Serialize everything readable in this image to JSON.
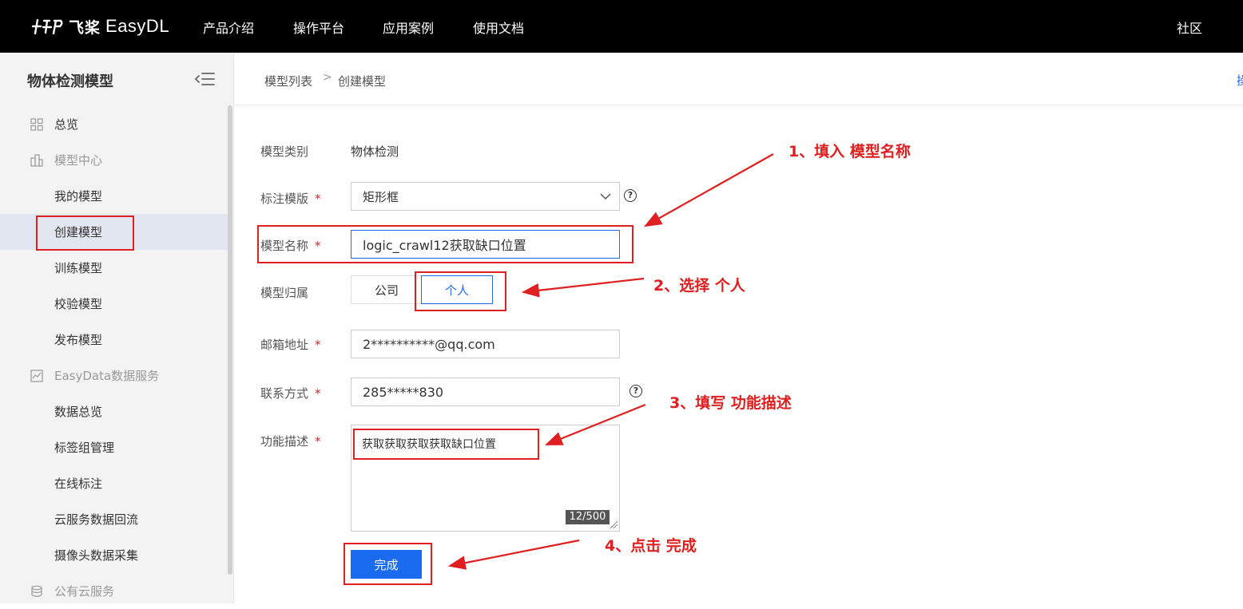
{
  "header": {
    "logo_cn": "飞桨",
    "logo_en": "EasyDL",
    "nav": [
      "产品介绍",
      "操作平台",
      "应用案例",
      "使用文档"
    ],
    "right_link": "社区"
  },
  "sidebar": {
    "title": "物体检测模型",
    "overview": "总览",
    "model_center": "模型中心",
    "model_items": [
      "我的模型",
      "创建模型",
      "训练模型",
      "校验模型",
      "发布模型"
    ],
    "data_service": "EasyData数据服务",
    "data_items": [
      "数据总览",
      "标签组管理",
      "在线标注",
      "云服务数据回流",
      "摄像头数据采集"
    ],
    "public_cloud": "公有云服务"
  },
  "breadcrumb": {
    "list": "模型列表",
    "sep": ">",
    "current": "创建模型",
    "edge": "操"
  },
  "form": {
    "type_label": "模型类别",
    "type_value": "物体检测",
    "template_label": "标注模版",
    "template_value": "矩形框",
    "name_label": "模型名称",
    "name_value": "logic_crawl12获取缺口位置",
    "owner_label": "模型归属",
    "owner_options": [
      "公司",
      "个人"
    ],
    "owner_selected": "个人",
    "email_label": "邮箱地址",
    "email_value": "2**********@qq.com",
    "contact_label": "联系方式",
    "contact_value": "285*****830",
    "desc_label": "功能描述",
    "desc_value": "获取获取获取获取缺口位置",
    "desc_counter": "12/500",
    "required_mark": "*",
    "help_mark": "?",
    "submit_label": "完成"
  },
  "annotations": {
    "step1": "1、填入 模型名称",
    "step2": "2、选择 个人",
    "step3": "3、填写 功能描述",
    "step4": "4、点击 完成",
    "color": "#e02020"
  },
  "colors": {
    "primary": "#1a6bf0",
    "topbar": "#000000",
    "sidebar_bg": "#f3f3f3",
    "active_bg": "#e1e6f0"
  }
}
